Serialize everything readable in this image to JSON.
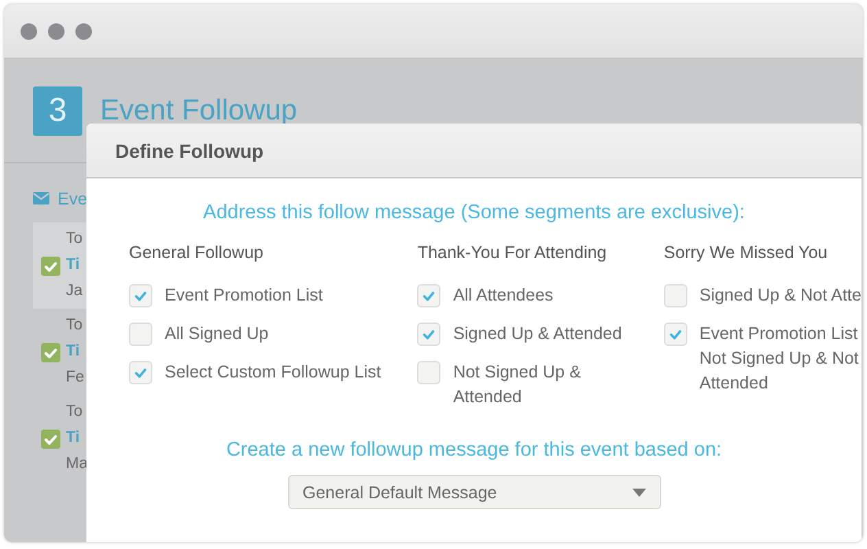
{
  "page": {
    "step": "3",
    "title": "Event Followup",
    "section_label": "Eve",
    "items": [
      {
        "line_1": "To",
        "line_2": "Ti",
        "line_3": "Ja",
        "checked": true
      },
      {
        "line_1": "To",
        "line_2": "Ti",
        "line_3": "Fe",
        "checked": true
      },
      {
        "line_1": "To",
        "line_2": "Ti",
        "line_3": "Ma",
        "checked": true
      }
    ]
  },
  "dialog": {
    "title": "Define Followup",
    "prompt": "Address this follow message (Some segments are exclusive):",
    "groups": [
      {
        "heading": "General Followup",
        "options": [
          {
            "label": "Event Promotion List",
            "checked": true
          },
          {
            "label": "All Signed Up",
            "checked": false
          },
          {
            "label": "Select Custom Followup List",
            "checked": true
          }
        ]
      },
      {
        "heading": "Thank-You For Attending",
        "options": [
          {
            "label": "All Attendees",
            "checked": true
          },
          {
            "label": "Signed Up & Attended",
            "checked": true
          },
          {
            "label": "Not Signed Up &\nAttended",
            "checked": false
          }
        ]
      },
      {
        "heading": "Sorry We Missed You",
        "options": [
          {
            "label": "Signed Up & Not Atte",
            "checked": false
          },
          {
            "label": "Event Promotion List\nNot Signed Up & Not\nAttended",
            "checked": true
          }
        ]
      }
    ],
    "template_prompt": "Create a new followup message for this event based on:",
    "template_select": {
      "value": "General Default Message"
    }
  }
}
